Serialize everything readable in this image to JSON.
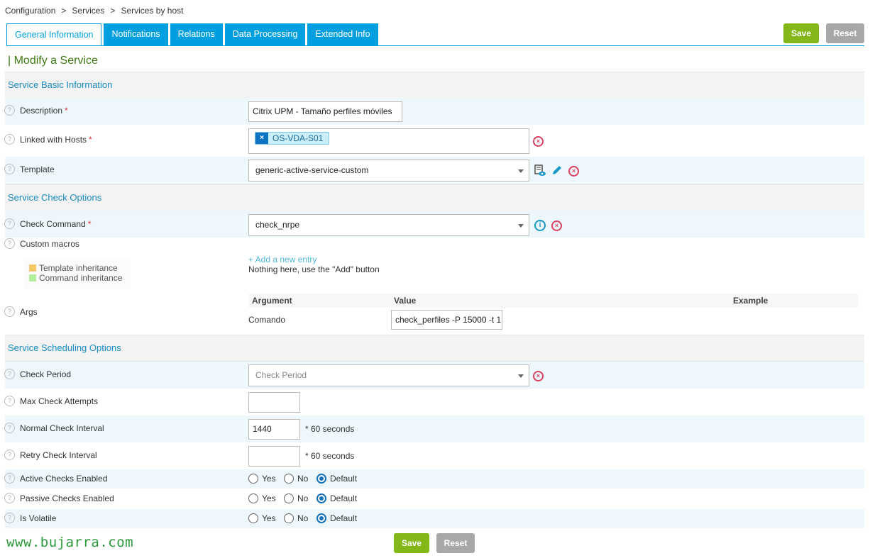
{
  "breadcrumb": [
    "Configuration",
    "Services",
    "Services by host"
  ],
  "breadcrumb_sep": ">",
  "tabs": [
    "General Information",
    "Notifications",
    "Relations",
    "Data Processing",
    "Extended Info"
  ],
  "buttons": {
    "save": "Save",
    "reset": "Reset"
  },
  "page_title": "| Modify a Service",
  "sections": {
    "basic": "Service Basic Information",
    "check": "Service Check Options",
    "scheduling": "Service Scheduling Options"
  },
  "fields": {
    "description": {
      "label": "Description",
      "required": "*",
      "value": "Citrix UPM - Tamaño perfiles móviles"
    },
    "linked_hosts": {
      "label": "Linked with Hosts",
      "required": "*",
      "tag": "OS-VDA-S01",
      "tag_remove": "×"
    },
    "template": {
      "label": "Template",
      "value": "generic-active-service-custom"
    },
    "check_command": {
      "label": "Check Command",
      "required": "*",
      "value": "check_nrpe"
    },
    "custom_macros": {
      "label": "Custom macros",
      "add_entry": "+ Add a new entry",
      "empty_text": "Nothing here, use the \"Add\" button"
    },
    "args": {
      "label": "Args",
      "headers": [
        "Argument",
        "Value",
        "Example"
      ],
      "rows": [
        {
          "argument": "Comando",
          "value": "check_perfiles -P 15000 -t 1"
        }
      ]
    },
    "check_period": {
      "label": "Check Period",
      "placeholder": "Check Period"
    },
    "max_check_attempts": {
      "label": "Max Check Attempts",
      "value": ""
    },
    "normal_check_interval": {
      "label": "Normal Check Interval",
      "value": "1440",
      "unit": "* 60 seconds"
    },
    "retry_check_interval": {
      "label": "Retry Check Interval",
      "value": "",
      "unit": "* 60 seconds"
    },
    "active_checks": {
      "label": "Active Checks Enabled",
      "selected": "Default"
    },
    "passive_checks": {
      "label": "Passive Checks Enabled",
      "selected": "Default"
    },
    "is_volatile": {
      "label": "Is Volatile",
      "selected": "Default"
    }
  },
  "radio_options": [
    "Yes",
    "No",
    "Default"
  ],
  "legend": {
    "template": {
      "label": "Template inheritance",
      "color": "#f5c86a"
    },
    "command": {
      "label": "Command inheritance",
      "color": "#b5ef9e"
    }
  },
  "help_glyph": "?",
  "watermark": "www.bujarra.com",
  "colors": {
    "accent": "#009fdf",
    "save": "#84b818",
    "reset": "#a8a8a8",
    "title": "#3e7a14"
  }
}
